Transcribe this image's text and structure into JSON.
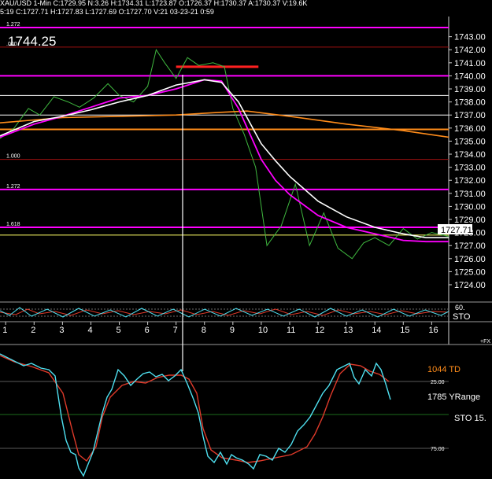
{
  "header": {
    "line1": "XAU/USD  1-Min  C:1729.95  N:3.26  H:1734.31  L:1723.87  O:1726.37  H:1730.37  A:1730.37  V:19.6K",
    "line2": "5:19  C:1727.71  H:1727.83  L:1727.69  O:1727.70  V:21  03-23-21  0:59"
  },
  "price_panel": {
    "big_price": "1744.25",
    "current_price": "1727.71",
    "y_ticks": [
      "1743.00",
      "1742.00",
      "1741.00",
      "1740.00",
      "1739.00",
      "1738.00",
      "1737.00",
      "1736.00",
      "1735.00",
      "1734.00",
      "1733.00",
      "1732.00",
      "1731.00",
      "1730.00",
      "1729.00",
      "1728.00",
      "1727.00",
      "1726.00",
      "1725.00",
      "1724.00"
    ],
    "fib_labels": [
      "1.272",
      ".000",
      "1.000",
      "1.272",
      "1.618"
    ]
  },
  "x_axis": {
    "ticks": [
      "1",
      "2",
      "3",
      "4",
      "5",
      "6",
      "7",
      "8",
      "9",
      "10",
      "11",
      "12",
      "13",
      "14",
      "15",
      "16"
    ],
    "fx_label": "+FX"
  },
  "small_panel": {
    "label": "STO",
    "value_partial": "60."
  },
  "lower_panel": {
    "labels": {
      "td": "1044 TD",
      "yrange": "1785 YRange",
      "sto": "STO  15."
    },
    "gridlines": [
      "25.00",
      "75.00"
    ]
  },
  "colors": {
    "magenta": "#ff00ff",
    "orange": "#ff8c1a",
    "white": "#ffffff",
    "red_line": "#e03a2a",
    "cyan": "#4fe0f0",
    "green_bars": "#3fb83f"
  },
  "chart_data": {
    "type": "line",
    "title": "",
    "xlabel": "",
    "ylabel": "",
    "xlim": [
      0.8,
      16.6
    ],
    "ylim": [
      1723,
      1744
    ],
    "horizontal_levels": [
      {
        "label": "1.272",
        "value": 1743.7,
        "color": "#ff00ff"
      },
      {
        "label": ".000",
        "value": 1742.2,
        "color": "#a01010"
      },
      {
        "label": "",
        "value": 1740.0,
        "color": "#ff00ff"
      },
      {
        "label": "",
        "value": 1738.5,
        "color": "#ffffff"
      },
      {
        "label": "",
        "value": 1737.0,
        "color": "#ffffff"
      },
      {
        "label": "",
        "value": 1735.9,
        "color": "#ff8c1a"
      },
      {
        "label": "1.000",
        "value": 1733.6,
        "color": "#a01010"
      },
      {
        "label": "1.272",
        "value": 1731.3,
        "color": "#ff00ff"
      },
      {
        "label": "1.618",
        "value": 1728.4,
        "color": "#ff00ff"
      },
      {
        "label": "",
        "value": 1727.8,
        "color": "#ffff66"
      }
    ],
    "resistance_segment": {
      "x": [
        7.0,
        9.9
      ],
      "value": 1740.7,
      "color": "#ff2020"
    },
    "series": [
      {
        "name": "",
        "color": "#ffffff",
        "x": [
          0.8,
          2,
          3,
          4,
          5,
          6,
          7,
          8,
          8.6,
          9.2,
          10,
          10.5,
          11,
          12,
          13,
          14,
          15,
          15.8,
          16.6
        ],
        "values": [
          1735.4,
          1736.5,
          1736.9,
          1737.4,
          1738.0,
          1738.5,
          1739.3,
          1739.7,
          1739.5,
          1738.0,
          1734.8,
          1733.5,
          1732.3,
          1730.4,
          1729.2,
          1728.4,
          1727.9,
          1727.6,
          1727.6
        ]
      },
      {
        "name": "",
        "color": "#ff00ff",
        "x": [
          0.8,
          2,
          3,
          4,
          5,
          6,
          7,
          8,
          8.6,
          9.2,
          10,
          10.5,
          11,
          12,
          13,
          14,
          15,
          15.8,
          16.6
        ],
        "values": [
          1735.3,
          1736.3,
          1736.9,
          1737.6,
          1738.3,
          1738.5,
          1739.0,
          1739.7,
          1739.6,
          1737.5,
          1733.6,
          1732.0,
          1730.9,
          1729.3,
          1728.4,
          1727.9,
          1727.4,
          1727.3,
          1727.3
        ]
      },
      {
        "name": "",
        "color": "#ff8c1a",
        "x": [
          0.8,
          3,
          5,
          7,
          8.5,
          9.5,
          11,
          13,
          15,
          16.6
        ],
        "values": [
          1736.4,
          1736.8,
          1736.9,
          1737.0,
          1737.2,
          1737.3,
          1736.9,
          1736.3,
          1735.8,
          1735.3
        ]
      },
      {
        "name": "",
        "color": "#3fb83f",
        "x": [
          0.8,
          1.3,
          1.8,
          2.2,
          2.7,
          3.2,
          3.6,
          4.1,
          4.6,
          5.0,
          5.5,
          6.0,
          6.3,
          6.6,
          7.0,
          7.4,
          7.8,
          8.3,
          8.7,
          9.0,
          9.4,
          9.8,
          10.2,
          10.7,
          11.2,
          11.7,
          12.2,
          12.7,
          13.2,
          13.6,
          14.0,
          14.5,
          15.0,
          15.5,
          16.0,
          16.6
        ],
        "values": [
          1735.2,
          1736.0,
          1737.5,
          1737.0,
          1738.4,
          1738.0,
          1737.6,
          1738.3,
          1739.4,
          1738.5,
          1738.0,
          1739.2,
          1742.0,
          1741.0,
          1739.8,
          1741.4,
          1740.8,
          1741.0,
          1740.7,
          1737.5,
          1735.5,
          1733.0,
          1727.0,
          1728.5,
          1731.7,
          1727.0,
          1729.5,
          1726.8,
          1726.0,
          1727.2,
          1727.6,
          1727.0,
          1728.3,
          1727.5,
          1728.0,
          1727.7
        ]
      }
    ]
  }
}
